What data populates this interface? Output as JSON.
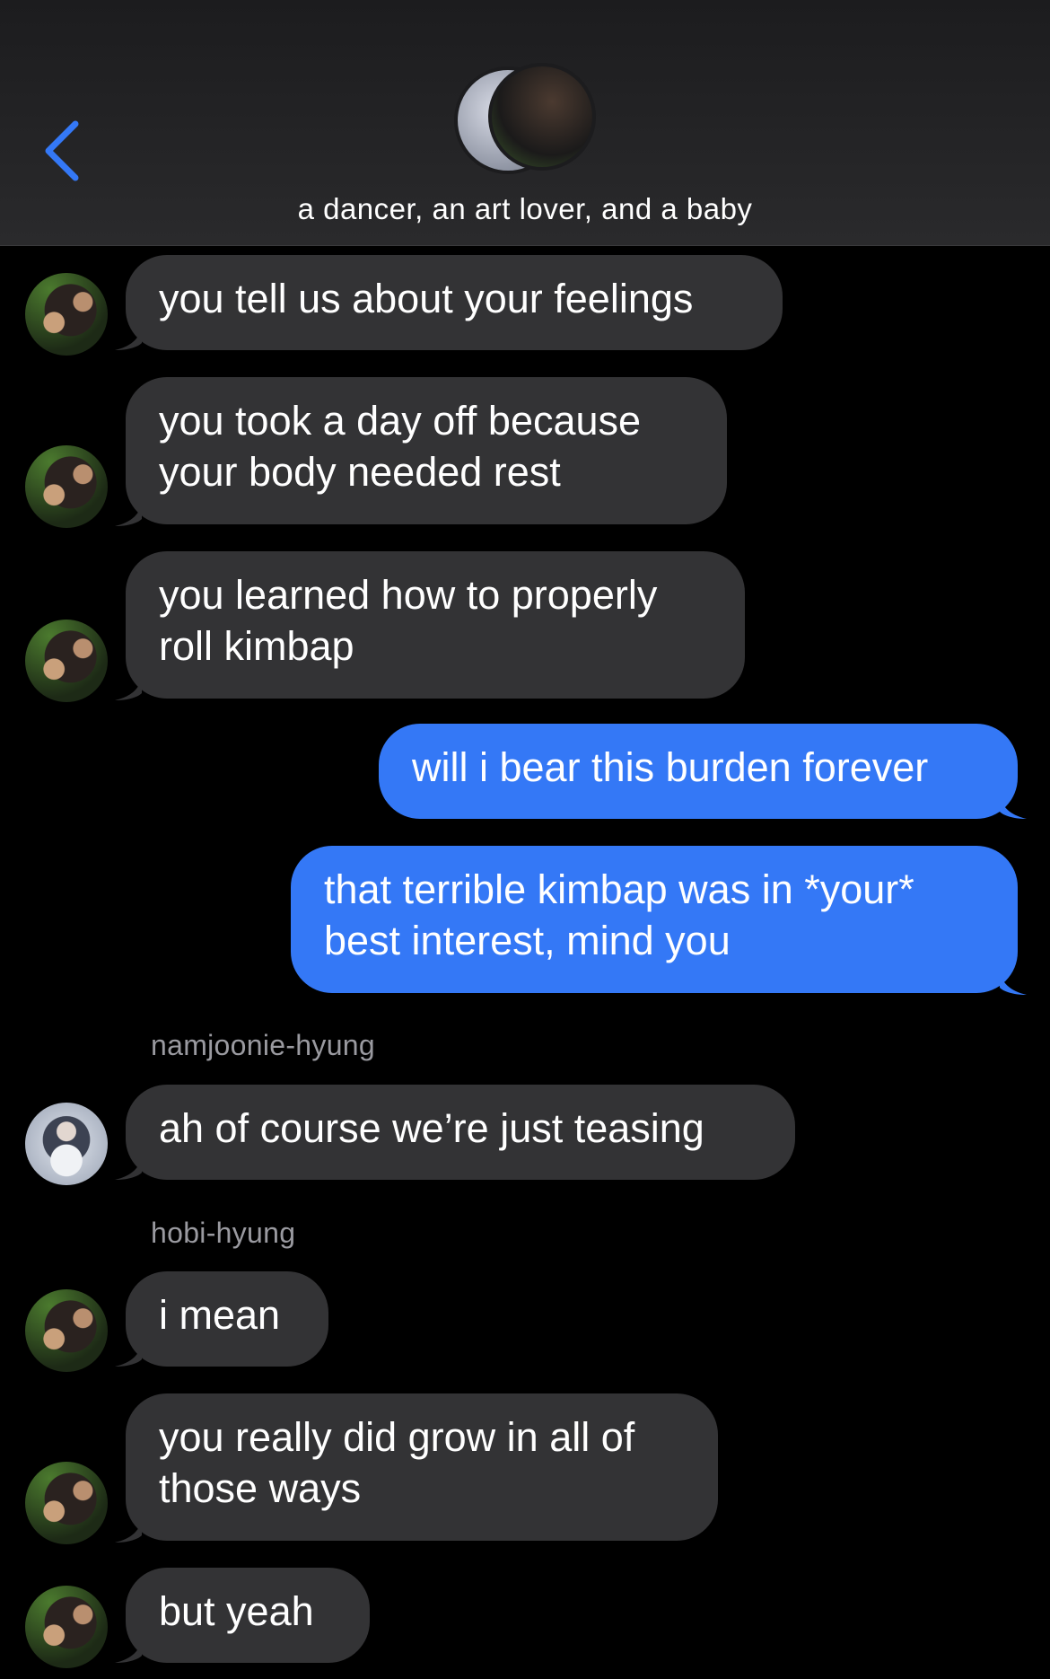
{
  "header": {
    "back_icon": "chevron-left-icon",
    "group_name": "a dancer, an art lover, and a baby",
    "accent": "#3478f6"
  },
  "messages": [
    {
      "direction": "in",
      "avatar": "a",
      "text": "you tell us about your feelings"
    },
    {
      "direction": "in",
      "avatar": "a",
      "text": "you took a day off because\nyour body needed rest"
    },
    {
      "direction": "in",
      "avatar": "a",
      "text": "you learned how to properly\nroll kimbap"
    },
    {
      "direction": "out",
      "text": "will i bear this burden forever"
    },
    {
      "direction": "out",
      "text": "that terrible kimbap was in *your*\nbest interest, mind you"
    },
    {
      "direction": "in",
      "avatar": "b",
      "sender": "namjoonie-hyung",
      "text": "ah of course we’re just teasing"
    },
    {
      "direction": "in",
      "avatar": "a",
      "sender": "hobi-hyung",
      "text": "i mean"
    },
    {
      "direction": "in",
      "avatar": "a",
      "text": "you really did grow in all of\nthose ways"
    },
    {
      "direction": "in",
      "avatar": "a",
      "text": "but yeah"
    }
  ],
  "colors": {
    "incoming_bubble": "#333335",
    "outgoing_bubble": "#3478f6",
    "background": "#000000",
    "sender_label": "#9a9aa0"
  }
}
